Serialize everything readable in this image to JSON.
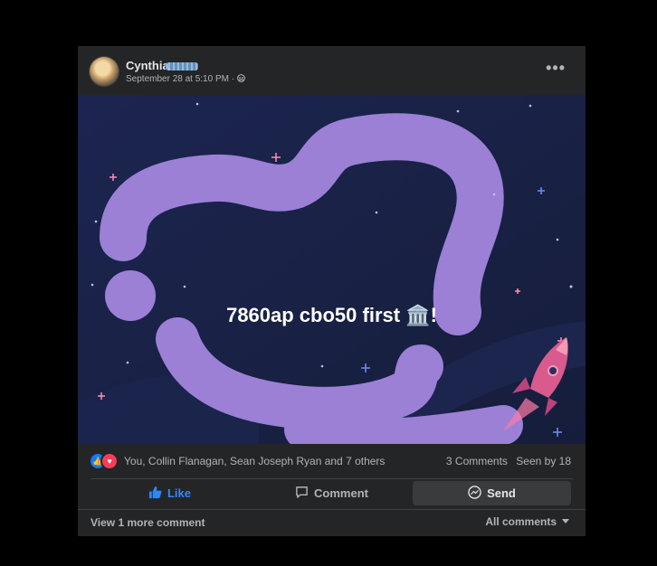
{
  "post": {
    "author": "Cynthia",
    "timestamp": "September 28 at 5:10 PM ·",
    "privacy_icon": "friends-icon",
    "more_icon": "more-horizontal-icon",
    "more_label": "•••",
    "text": "7860ap cbo50 first 🏛️!",
    "background_colors": {
      "sky": "#1a2346",
      "blob": "#9b7fd6",
      "rocket": "#d95a8c"
    }
  },
  "reactions": {
    "icons": [
      "like-icon",
      "love-icon"
    ],
    "summary": "You, Collin Flanagan, Sean Joseph Ryan and 7 others",
    "comments": "3 Comments",
    "seen_by": "Seen by 18"
  },
  "actions": {
    "like": "Like",
    "comment": "Comment",
    "send": "Send"
  },
  "footer": {
    "view_more": "View 1 more comment",
    "all_comments": "All comments"
  }
}
